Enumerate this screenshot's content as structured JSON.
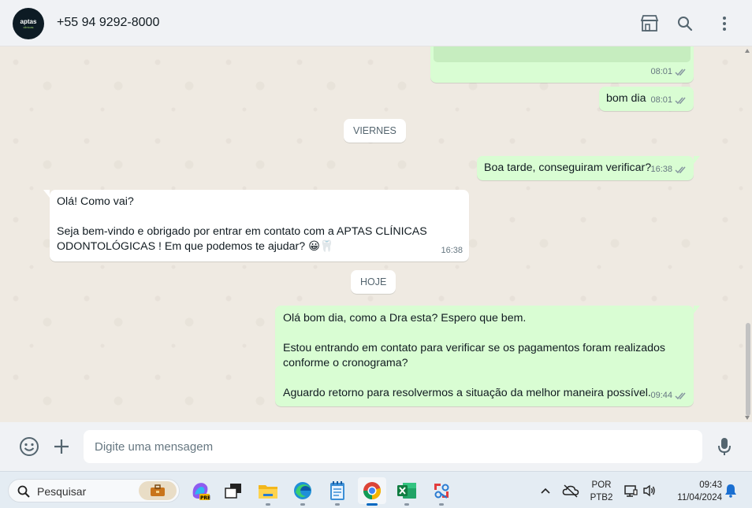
{
  "header": {
    "avatar_text": "aptas",
    "avatar_sub": "clinicas",
    "contact": "+55 94 9292-8000"
  },
  "messages": {
    "m1_time": "08:01",
    "m2_text": "bom dia",
    "m2_time": "08:01",
    "date1": "VIERNES",
    "m3_text": "Boa tarde, conseguiram verificar?",
    "m3_time": "16:38",
    "m4_line1": "Olá! Como vai?",
    "m4_line2": "Seja bem-vindo e obrigado por entrar em contato com a APTAS CLÍNICAS",
    "m4_line3": "ODONTOLÓGICAS ! Em que podemos te ajudar? 😀🦷",
    "m4_time": "16:38",
    "date2": "HOJE",
    "m5_line1": "Olá bom dia, como a Dra esta? Espero que bem.",
    "m5_line2": "Estou entrando em contato para verificar se os pagamentos foram realizados",
    "m5_line3": "conforme o cronograma?",
    "m5_line4": "Aguardo retorno para resolvermos a situação da melhor maneira possível.",
    "m5_time": "09:44"
  },
  "composer": {
    "placeholder": "Digite uma mensagem"
  },
  "taskbar": {
    "search_label": "Pesquisar",
    "lang1": "POR",
    "lang2": "PTB2",
    "time": "09:43",
    "date": "11/04/2024"
  },
  "colors": {
    "outgoing": "#d9fdd3",
    "incoming": "#ffffff",
    "tick_read": "#8696a0"
  }
}
